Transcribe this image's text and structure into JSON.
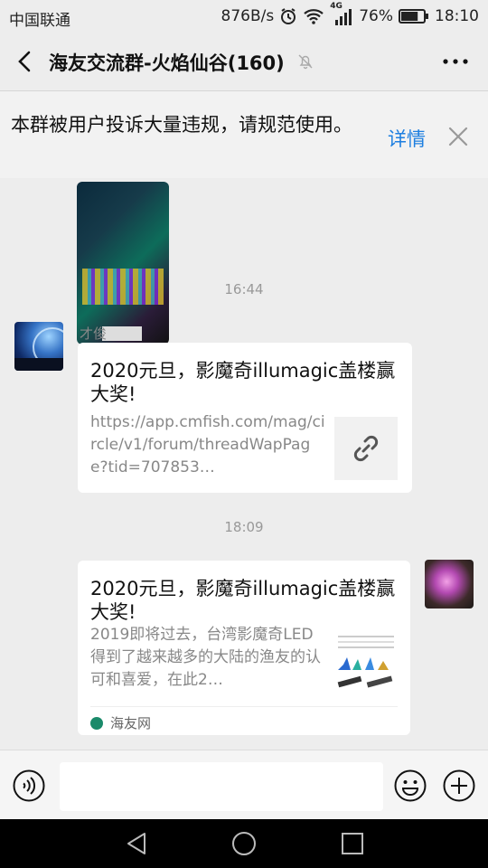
{
  "status": {
    "carrier": "中国联通",
    "speed": "876B/s",
    "network": "4G",
    "battery": "76%",
    "time": "18:10",
    "battery_level": 0.76
  },
  "header": {
    "title": "海友交流群-火焰仙谷(160)",
    "back_icon": "chevron-left-icon",
    "mute_icon": "bell-off-icon",
    "more_icon": "more-dots-icon"
  },
  "banner": {
    "text": "本群被用户投诉大量违规，请规范使用。",
    "detail_label": "详情",
    "close_icon": "close-icon"
  },
  "chat": {
    "messages": [
      {
        "timestamp": "16:44",
        "sender": "才俊",
        "title": "2020元旦，影魔奇illumagic盖楼赢大奖!",
        "desc": "https://app.cmfish.com/mag/circle/v1/forum/threadWapPage?tid=707853…",
        "icon": "link-icon"
      },
      {
        "timestamp": "18:09",
        "title": "2020元旦，影魔奇illumagic盖楼赢大奖!",
        "desc": "2019即将过去，台湾影魔奇LED得到了越来越多的大陆的渔友的认可和喜爱，在此2…",
        "source": "海友网"
      }
    ]
  },
  "input": {
    "placeholder": "",
    "voice_icon": "voice-icon",
    "emoji_icon": "emoji-icon",
    "plus_icon": "plus-icon"
  },
  "navbar": {
    "back_icon": "nav-back-icon",
    "home_icon": "nav-home-icon",
    "recent_icon": "nav-recent-icon"
  },
  "colors": {
    "background": "#ededed",
    "accent": "#1e7fe0",
    "card": "#ffffff"
  }
}
